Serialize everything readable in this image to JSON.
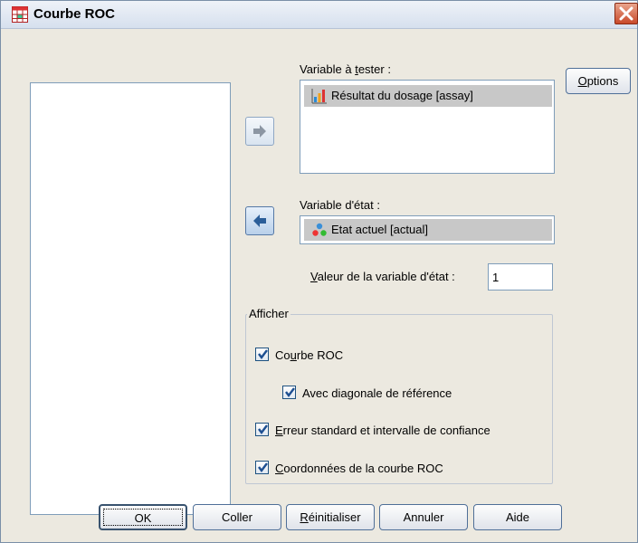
{
  "window": {
    "title": "Courbe ROC"
  },
  "test_variable": {
    "label_pre": "Variable à ",
    "label_mnemonic": "t",
    "label_post": "ester :",
    "items": [
      {
        "icon": "scale-bar-chart-icon",
        "text": "Résultat du dosage [assay]"
      }
    ]
  },
  "state_variable": {
    "label": "Variable d'état :",
    "item": {
      "icon": "nominal-people-icon",
      "text": "Etat actuel [actual]"
    }
  },
  "state_value": {
    "label_mnemonic": "V",
    "label_rest": "aleur de la variable d'état :",
    "value": "1"
  },
  "options_button": {
    "mnemonic": "O",
    "rest": "ptions"
  },
  "display_group": {
    "legend": "Afficher",
    "roc_curve": {
      "pre": "Co",
      "mnemonic": "u",
      "post": "rbe ROC",
      "checked": true
    },
    "diagonal": {
      "text": "Avec diagonale de référence",
      "checked": true
    },
    "std_error": {
      "mnemonic": "E",
      "rest": "rreur standard et intervalle de confiance",
      "checked": true
    },
    "coords": {
      "mnemonic": "C",
      "rest": "oordonnées de la courbe ROC",
      "checked": true
    }
  },
  "buttons": {
    "ok": "OK",
    "paste": "Coller",
    "reset_mnemonic": "R",
    "reset_rest": "éinitialiser",
    "cancel": "Annuler",
    "help": "Aide"
  },
  "colors": {
    "selection": "#c8c8c8",
    "check": "#1d4f91",
    "accent": "#3b6eb4"
  }
}
